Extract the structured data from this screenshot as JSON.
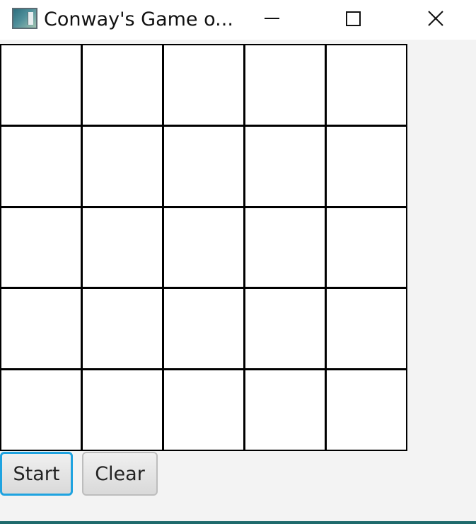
{
  "window": {
    "title": "Conway's Game o...",
    "icon": "app-window-icon",
    "controls": {
      "minimize_icon": "minimize-icon",
      "maximize_icon": "maximize-icon",
      "close_icon": "close-icon"
    }
  },
  "board": {
    "rows": 5,
    "cols": 5,
    "cells": [
      [
        0,
        0,
        0,
        0,
        0
      ],
      [
        0,
        0,
        0,
        0,
        0
      ],
      [
        0,
        0,
        0,
        0,
        0
      ],
      [
        0,
        0,
        0,
        0,
        0
      ],
      [
        0,
        0,
        0,
        0,
        0
      ]
    ]
  },
  "toolbar": {
    "start_label": "Start",
    "clear_label": "Clear"
  },
  "colors": {
    "focus_accent": "#1fa3e0",
    "cell_dead": "#ffffff",
    "cell_alive": "#000000",
    "grid_line": "#000000",
    "bottom_border": "#1f6a6c"
  }
}
